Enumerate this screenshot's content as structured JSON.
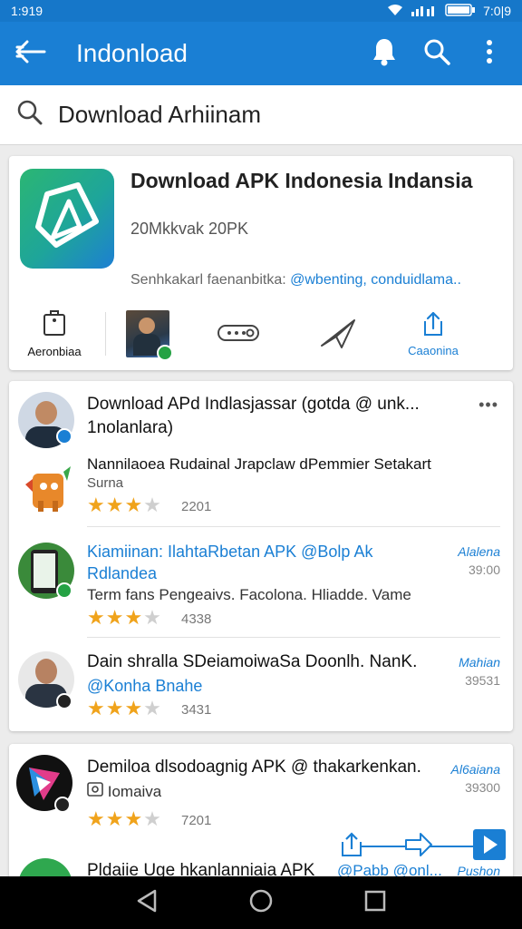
{
  "status": {
    "time_left": "1:919",
    "time_right": "7:0|9"
  },
  "appbar": {
    "title": "Indonload"
  },
  "search": {
    "value": "Download Arhiinam"
  },
  "hero": {
    "title": "Download APK Indonesia Indansia",
    "subtitle": "20Mkkvak 20PK",
    "description_prefix": "Senhkakarl faenanbitka: ",
    "description_accent": "@wbenting, conduidlama..",
    "actions": [
      {
        "label": "Aeronbiaa"
      },
      {
        "label": ""
      },
      {
        "label": ""
      },
      {
        "label": ""
      },
      {
        "label": "Caaonina"
      }
    ]
  },
  "feed": {
    "post": {
      "title": "Download APd Indlasjassar (gotda @ unk...",
      "title2": "1nolanlara)",
      "more": "•••"
    },
    "items": [
      {
        "title": "Nannilaoea Rudainal Jrapclaw dPemmier Setakart",
        "sub": "Surna",
        "count": "2201",
        "rating": 3
      },
      {
        "title": "Kiamiinan: IlahtaRbetan APK @Bolp Ak",
        "title2": "Rdlandea",
        "sub": "Term fans Pengeaivs. Facolona. Hliadde. Vame",
        "count": "4338",
        "rating": 3,
        "side": "Alalena",
        "time": "39:00"
      },
      {
        "title": "Dain shralla SDeiamoiwaSa Doonlh. NanK.",
        "title2": "@Konha Bnahe",
        "count": "3431",
        "rating": 3,
        "side": "Mahian",
        "time": "39531"
      }
    ]
  },
  "feed2": {
    "item": {
      "title": "Demiloa dlsodoagnig APK @ thakarkenkan.",
      "sub": "Iomaiva",
      "count": "7201",
      "rating": 3,
      "side": "Al6aiana",
      "time": "39300"
    },
    "partial": {
      "title": "Pldaiie Uge hkanlanniaia APK",
      "accent": "@Pabb @onl...",
      "side": "Pushon"
    }
  },
  "colors": {
    "primary": "#1a7fd4",
    "star": "#f0a31b"
  }
}
